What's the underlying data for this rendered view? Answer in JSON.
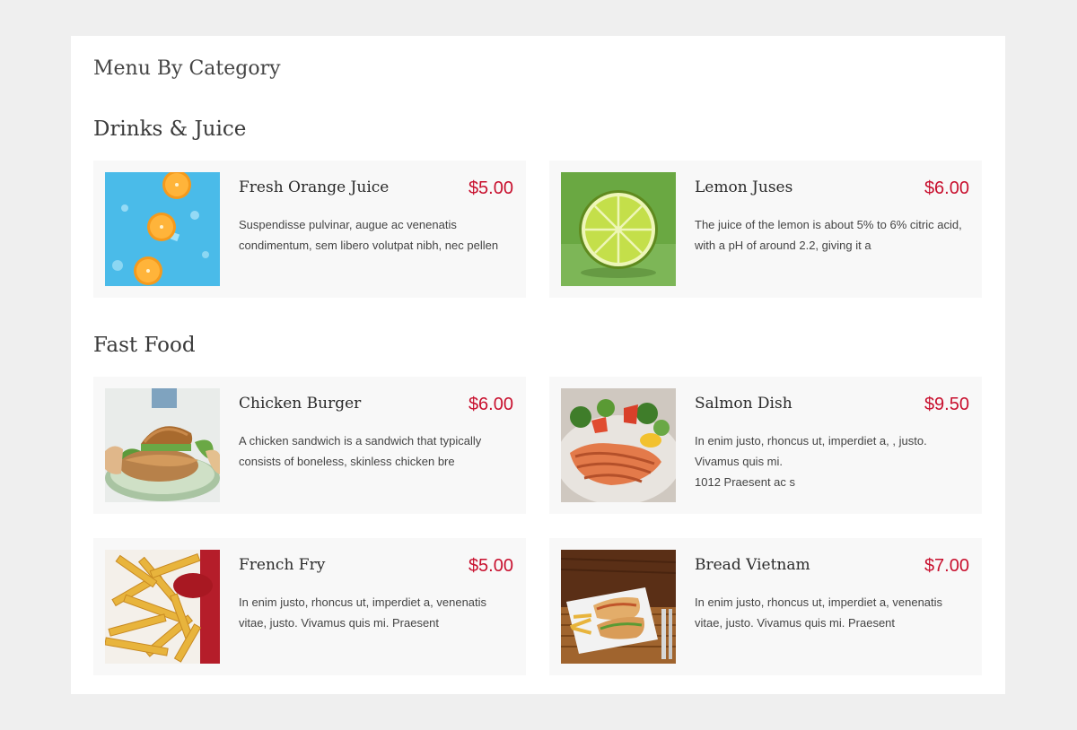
{
  "page": {
    "title": "Menu By Category"
  },
  "categories": [
    {
      "title": "Drinks & Juice",
      "items": [
        {
          "name": "Fresh Orange Juice",
          "price": "$5.00",
          "description": "Suspendisse pulvinar, augue ac venenatis condimentum, sem libero volutpat nibh, nec pellen",
          "image": "orange-slices-image"
        },
        {
          "name": "Lemon Juses",
          "price": "$6.00",
          "description": "The juice of the lemon is about 5% to 6% citric acid, with a pH of around 2.2, giving it a",
          "image": "lime-slice-image"
        }
      ]
    },
    {
      "title": "Fast Food",
      "items": [
        {
          "name": "Chicken Burger",
          "price": "$6.00",
          "description": "A chicken sandwich is a sandwich that typically consists of boneless, skinless chicken bre",
          "image": "chicken-burger-image"
        },
        {
          "name": "Salmon Dish",
          "price": "$9.50",
          "description": "In enim justo, rhoncus ut, imperdiet a, , justo. Vivamus quis mi.\n1012 Praesent ac s",
          "image": "salmon-dish-image"
        },
        {
          "name": "French Fry",
          "price": "$5.00",
          "description": "In enim justo, rhoncus ut, imperdiet a, venenatis vitae, justo. Vivamus quis mi. Praesent",
          "image": "french-fries-image"
        },
        {
          "name": "Bread Vietnam",
          "price": "$7.00",
          "description": "In enim justo, rhoncus ut, imperdiet a, venenatis vitae, justo. Vivamus quis mi. Praesent",
          "image": "banh-mi-image"
        }
      ]
    }
  ],
  "colors": {
    "background": "#efefef",
    "panel": "#ffffff",
    "card": "#f8f8f8",
    "price": "#c8102e",
    "heading": "#3a3a3a"
  }
}
